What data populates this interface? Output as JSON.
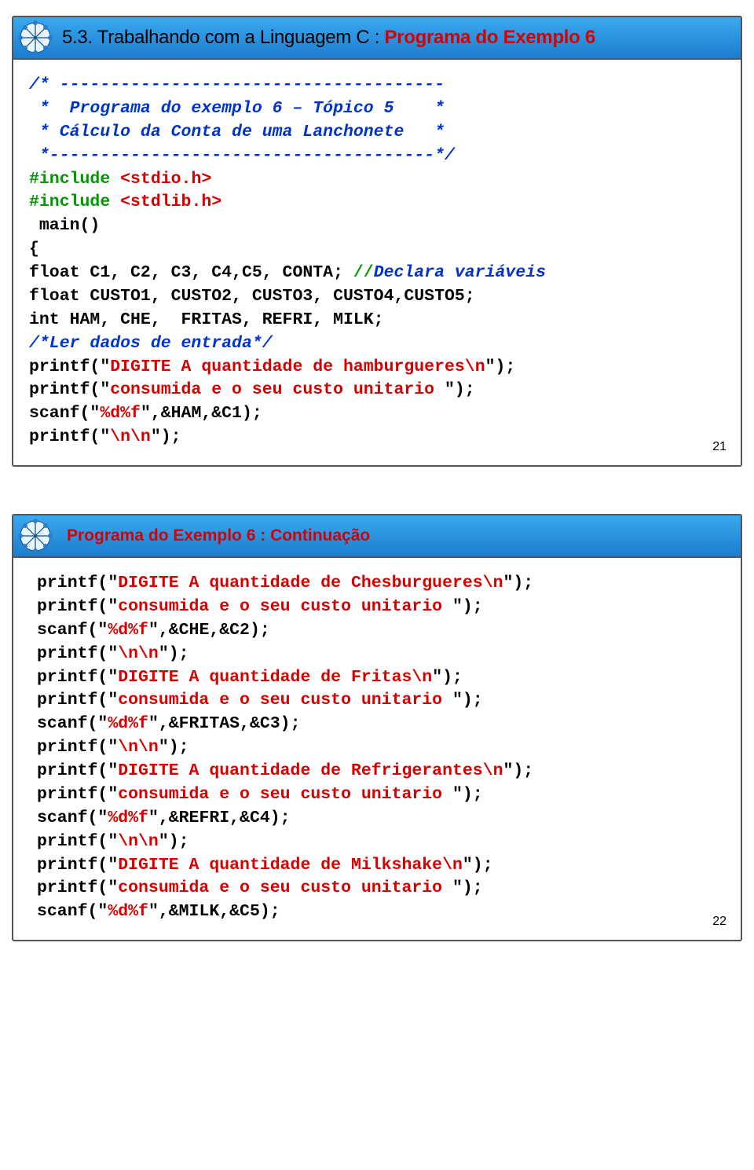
{
  "slide1": {
    "title_prefix": "5.3. Trabalhando com a Linguagem C :",
    "title_suffix": " Programa do Exemplo 6",
    "page": "21",
    "c1": "/* --------------------------------------",
    "c2a": " *  Programa do exemplo 6 – Tópico 5    *",
    "c2b": " * Cálculo da Conta de uma Lanchonete   *",
    "c3": " *--------------------------------------*/",
    "inc1a": "#include ",
    "inc1b": "<stdio.h>",
    "inc2a": "#include ",
    "inc2b": "<stdlib.h>",
    "main": " main()",
    "ob": "{",
    "l1a": "float C1, C2, C3, C4,C5, CONTA; ",
    "l1b": "//",
    "l1c": "Declara variáveis",
    "l2": "float CUSTO1, CUSTO2, CUSTO3, CUSTO4,CUSTO5;",
    "l3": "int HAM, CHE,  FRITAS, REFRI, MILK;",
    "l4": "/*Ler dados de entrada*/",
    "p1a": "printf(\"",
    "p1b": "DIGITE A quantidade de hamburgueres\\n",
    "p1c": "\");",
    "p2a": "printf(\"",
    "p2b": "consumida e o seu custo unitario ",
    "p2c": "\");",
    "s1a": "scanf(\"",
    "s1b": "%d%f",
    "s1c": "\",&HAM,&C1);",
    "p3a": "printf(\"",
    "p3b": "\\n\\n",
    "p3c": "\");"
  },
  "slide2": {
    "title": "Programa do Exemplo 6 : Continuação",
    "page": "22",
    "p1a": "printf(\"",
    "p1b": "DIGITE A quantidade de Chesburgueres\\n",
    "p1c": "\");",
    "p2a": "printf(\"",
    "p2b": "consumida e o seu custo unitario ",
    "p2c": "\");",
    "s1a": "scanf(\"",
    "s1b": "%d%f",
    "s1c": "\",&CHE,&C2);",
    "n1a": "printf(\"",
    "n1b": "\\n\\n",
    "n1c": "\");",
    "p3a": "printf(\"",
    "p3b": "DIGITE A quantidade de Fritas\\n",
    "p3c": "\");",
    "p4a": "printf(\"",
    "p4b": "consumida e o seu custo unitario ",
    "p4c": "\");",
    "s2a": "scanf(\"",
    "s2b": "%d%f",
    "s2c": "\",&FRITAS,&C3);",
    "n2a": "printf(\"",
    "n2b": "\\n\\n",
    "n2c": "\");",
    "p5a": "printf(\"",
    "p5b": "DIGITE A quantidade de Refrigerantes\\n",
    "p5c": "\");",
    "p6a": "printf(\"",
    "p6b": "consumida e o seu custo unitario ",
    "p6c": "\");",
    "s3a": "scanf(\"",
    "s3b": "%d%f",
    "s3c": "\",&REFRI,&C4);",
    "n3a": "printf(\"",
    "n3b": "\\n\\n",
    "n3c": "\");",
    "p7a": "printf(\"",
    "p7b": "DIGITE A quantidade de Milkshake\\n",
    "p7c": "\");",
    "p8a": "printf(\"",
    "p8b": "consumida e o seu custo unitario ",
    "p8c": "\");",
    "s4a": "scanf(\"",
    "s4b": "%d%f",
    "s4c": "\",&MILK,&C5);"
  }
}
